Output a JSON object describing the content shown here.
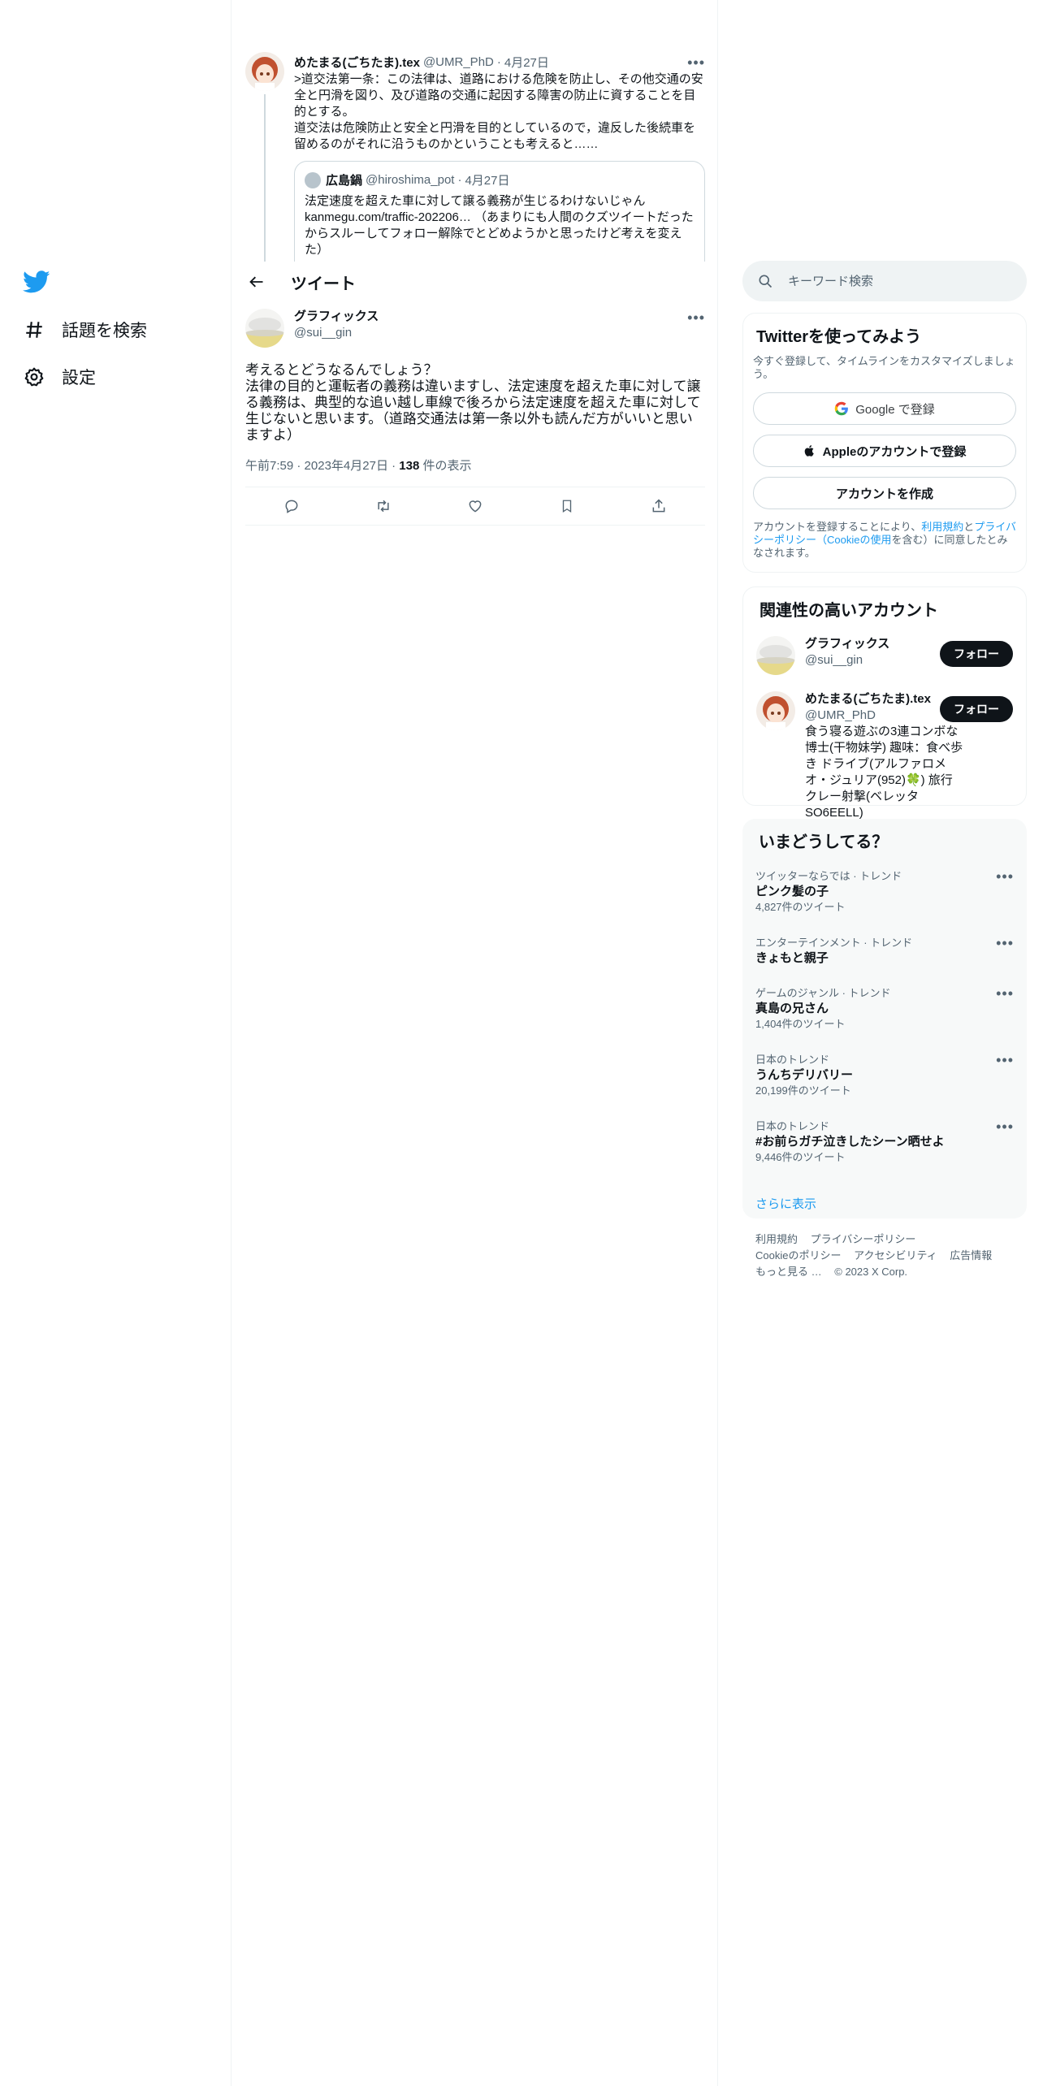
{
  "nav": {
    "items": [
      {
        "label": "話題を検索",
        "icon": "hashtag-icon"
      },
      {
        "label": "設定",
        "icon": "gear-icon"
      }
    ]
  },
  "thread": {
    "name": "めたまる(ごちたま).tex",
    "handle": "@UMR_PhD",
    "dot": "·",
    "date": "4月27日",
    "text": ">道交法第一条：この法律は、道路における危険を防止し、その他交通の安全と円滑を図り、及び道路の交通に起因する障害の防止に資することを目的とする。\n道交法は危険防止と安全と円滑を目的としているので，違反した後続車を留めるのがそれに沿うものかということも考えると……",
    "quote": {
      "name": "広島鍋",
      "handle": "@hiroshima_pot",
      "dot": "·",
      "date": "4月27日",
      "text": "法定速度を超えた車に対して譲る義務が生じるわけないじゃん kanmegu.com/traffic-202206… （あまりにも人間のクズツイートだったからスルーしてフォロー解除でとどめようかと思ったけど考えを変えた）"
    }
  },
  "header": {
    "title": "ツイート"
  },
  "tweet": {
    "name": "グラフィックス",
    "handle": "@sui__gin",
    "text": "考えるとどうなるんでしょう？\n法律の目的と運転者の義務は違いますし、法定速度を超えた車に対して譲る義務は、典型的な追い越し車線で後ろから法定速度を超えた車に対して生じないと思います。（道路交通法は第一条以外も読んだ方がいいと思いますよ）",
    "time": "午前7:59",
    "dot1": "·",
    "date": "2023年4月27日",
    "dot2": "·",
    "views_count": "138",
    "views_label": " 件の表示"
  },
  "search": {
    "placeholder": "キーワード検索"
  },
  "signup": {
    "title": "Twitterを使ってみよう",
    "subtitle": "今すぐ登録して、タイムラインをカスタマイズしましょう。",
    "google_label": "Google で登録",
    "apple_label": "Appleのアカウントで登録",
    "create_label": "アカウントを作成",
    "terms_pre": "アカウントを登録することにより、",
    "terms_link1": "利用規約",
    "terms_mid": "と",
    "terms_link2": "プライバシーポリシー（Cookieの使用",
    "terms_post": "を含む）に同意したとみなされます。"
  },
  "related": {
    "title": "関連性の高いアカウント",
    "follow_label": "フォロー",
    "users": [
      {
        "name": "グラフィックス",
        "handle": "@sui__gin",
        "bio": ""
      },
      {
        "name": "めたまる(ごちたま).tex",
        "handle": "@UMR_PhD",
        "bio": "食う寝る遊ぶの3連コンボな博士(干物妹学) 趣味：食べ歩き ドライブ(アルファロメオ・ジュリア(952)🍀) 旅行 クレー射撃(ベレッタ SO6EELL)"
      }
    ]
  },
  "trends": {
    "title": "いまどうしてる？",
    "items": [
      {
        "context": "ツイッターならでは · トレンド",
        "name": "ピンク髪の子",
        "count": "4,827件のツイート"
      },
      {
        "context": "エンターテインメント · トレンド",
        "name": "きょもと親子",
        "count": ""
      },
      {
        "context": "ゲームのジャンル · トレンド",
        "name": "真島の兄さん",
        "count": "1,404件のツイート"
      },
      {
        "context": "日本のトレンド",
        "name": "うんちデリバリー",
        "count": "20,199件のツイート"
      },
      {
        "context": "日本のトレンド",
        "name": "#お前らガチ泣きしたシーン晒せよ",
        "count": "9,446件のツイート"
      }
    ],
    "show_more": "さらに表示"
  },
  "footer": {
    "links": [
      "利用規約",
      "プライバシーポリシー",
      "Cookieのポリシー",
      "アクセシビリティ",
      "広告情報",
      "もっと見る …"
    ],
    "copyright": "© 2023 X Corp."
  },
  "colors": {
    "accent": "#1d9bf0",
    "text": "#0f1419",
    "muted": "#536471",
    "border": "#eff3f4"
  }
}
